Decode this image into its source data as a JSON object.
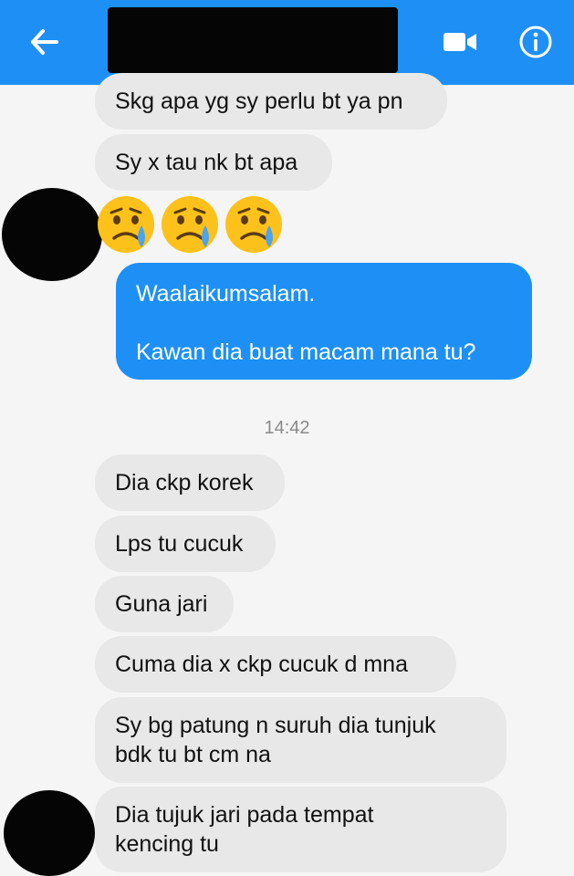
{
  "header": {
    "back_label": "Back",
    "video_label": "Video call",
    "info_label": "Conversation info"
  },
  "timestamp": "14:42",
  "messages": [
    {
      "direction": "incoming",
      "lines": [
        "Skg apa yg sy perlu bt ya pn"
      ]
    },
    {
      "direction": "incoming",
      "lines": [
        "Sy x tau nk bt apa"
      ]
    },
    {
      "direction": "incoming",
      "emoji": [
        "sad-tear-face",
        "sad-tear-face",
        "sad-tear-face"
      ]
    },
    {
      "direction": "outgoing",
      "lines": [
        "Waalaikumsalam.",
        "",
        "Kawan dia buat macam mana tu?"
      ]
    },
    {
      "direction": "incoming",
      "lines": [
        "Dia ckp korek"
      ]
    },
    {
      "direction": "incoming",
      "lines": [
        "Lps tu cucuk"
      ]
    },
    {
      "direction": "incoming",
      "lines": [
        "Guna jari"
      ]
    },
    {
      "direction": "incoming",
      "lines": [
        "Cuma dia x ckp cucuk d mna"
      ]
    },
    {
      "direction": "incoming",
      "lines": [
        "Sy bg patung n suruh dia tunjuk",
        "bdk tu bt cm na"
      ]
    },
    {
      "direction": "incoming",
      "lines": [
        "Dia tujuk jari pada tempat",
        "kencing tu"
      ]
    }
  ],
  "colors": {
    "accent": "#1e90f5",
    "incoming_bubble": "#e8e8e8",
    "background": "#f5f5f5"
  }
}
